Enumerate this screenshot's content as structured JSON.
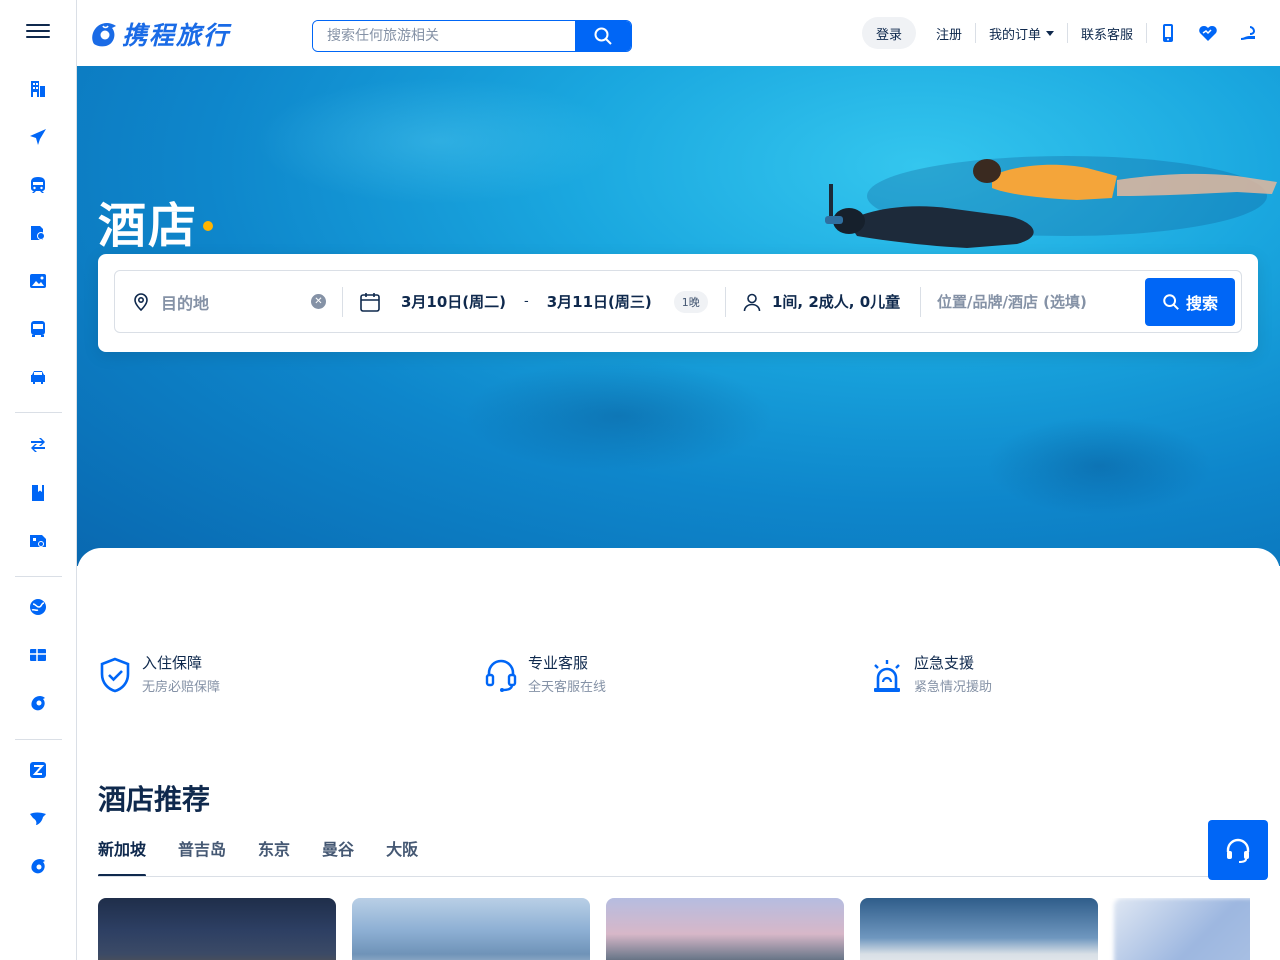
{
  "header": {
    "brand": "携程旅行",
    "search_placeholder": "搜索任何旅游相关",
    "nav": {
      "login": "登录",
      "register": "注册",
      "orders": "我的订单",
      "service": "联系客服"
    }
  },
  "sidebar": {
    "items": [
      {
        "name": "hotel-icon"
      },
      {
        "name": "flight-icon"
      },
      {
        "name": "train-icon"
      },
      {
        "name": "tour-icon"
      },
      {
        "name": "attraction-icon"
      },
      {
        "name": "bus-icon"
      },
      {
        "name": "car-icon"
      },
      {
        "name": "exchange-icon"
      },
      {
        "name": "guide-icon"
      },
      {
        "name": "cruise-icon"
      },
      {
        "name": "global-icon"
      },
      {
        "name": "gift-card-icon"
      },
      {
        "name": "dolphin-icon"
      },
      {
        "name": "z-icon"
      },
      {
        "name": "bird-icon"
      },
      {
        "name": "trip-icon"
      }
    ]
  },
  "hero": {
    "title": "酒店"
  },
  "booking": {
    "destination_placeholder": "目的地",
    "checkin": "3月10日(周二)",
    "separator": "-",
    "checkout": "3月11日(周三)",
    "nights": "1晚",
    "guests": "1间, 2成人, 0儿童",
    "keyword_placeholder": "位置/品牌/酒店 (选填)",
    "search_label": "搜索"
  },
  "guarantees": [
    {
      "title": "入住保障",
      "desc": "无房必赔保障"
    },
    {
      "title": "专业客服",
      "desc": "全天客服在线"
    },
    {
      "title": "应急支援",
      "desc": "紧急情况援助"
    }
  ],
  "recommend": {
    "title": "酒店推荐",
    "tabs": [
      "新加坡",
      "普吉岛",
      "东京",
      "曼谷",
      "大阪"
    ]
  },
  "colors": {
    "brand": "#0066f6",
    "text": "#0f294d",
    "muted": "#8592a6",
    "accent_dot": "#ffb400"
  }
}
